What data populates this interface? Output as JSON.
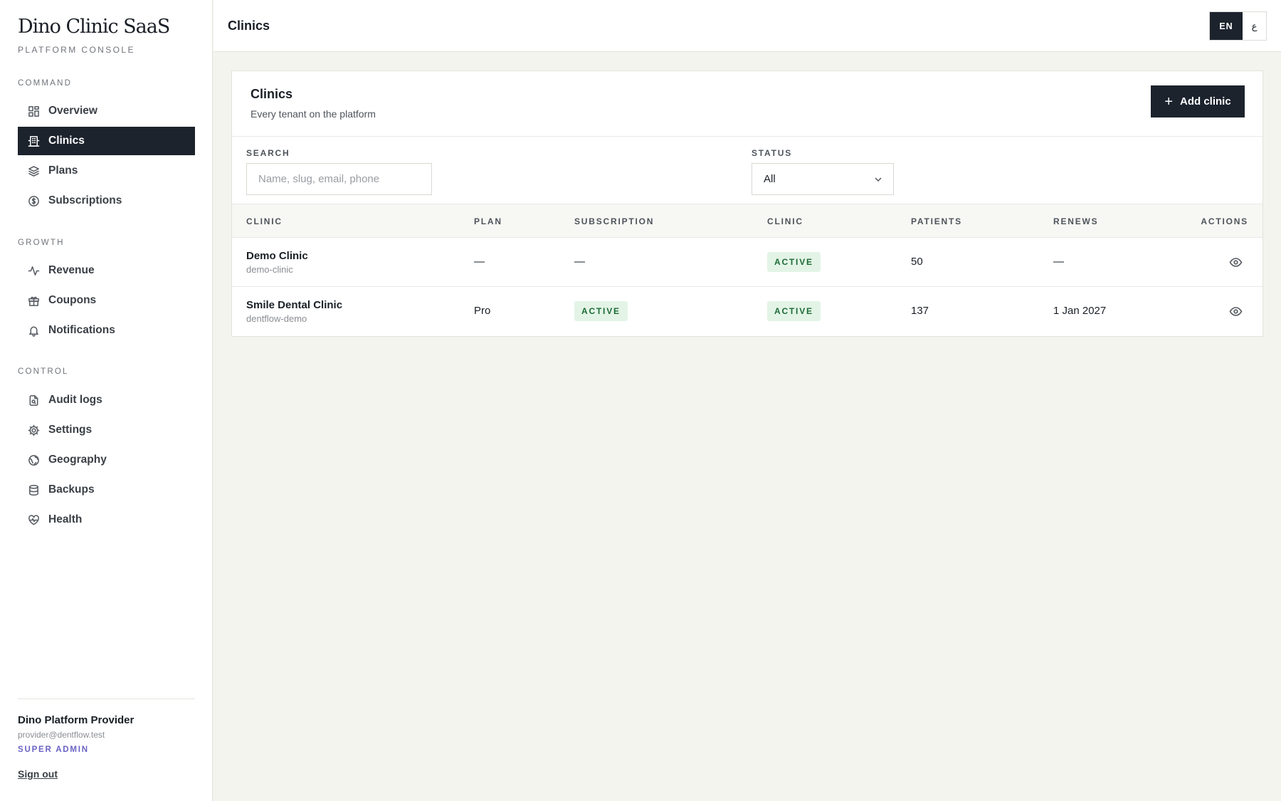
{
  "brand": {
    "title": "Dino Clinic SaaS",
    "subtitle": "PLATFORM CONSOLE"
  },
  "sidebar": {
    "sections": [
      {
        "label": "COMMAND"
      },
      {
        "label": "GROWTH"
      },
      {
        "label": "CONTROL"
      }
    ],
    "items": [
      {
        "label": "Overview",
        "icon": "grid-icon"
      },
      {
        "label": "Clinics",
        "icon": "building-icon",
        "active": true
      },
      {
        "label": "Plans",
        "icon": "layers-icon"
      },
      {
        "label": "Subscriptions",
        "icon": "dollar-circle-icon"
      },
      {
        "label": "Revenue",
        "icon": "activity-icon"
      },
      {
        "label": "Coupons",
        "icon": "gift-icon"
      },
      {
        "label": "Notifications",
        "icon": "bell-icon"
      },
      {
        "label": "Audit logs",
        "icon": "file-search-icon"
      },
      {
        "label": "Settings",
        "icon": "gear-icon"
      },
      {
        "label": "Geography",
        "icon": "globe-icon"
      },
      {
        "label": "Backups",
        "icon": "database-icon"
      },
      {
        "label": "Health",
        "icon": "heart-pulse-icon"
      }
    ],
    "user": {
      "name": "Dino Platform Provider",
      "email": "provider@dentflow.test",
      "role": "SUPER ADMIN",
      "sign_out": "Sign out"
    }
  },
  "topbar": {
    "title": "Clinics",
    "lang_en": "EN",
    "lang_ar": "ع"
  },
  "card": {
    "title": "Clinics",
    "subtitle": "Every tenant on the platform",
    "add_button": "Add clinic",
    "search_label": "SEARCH",
    "search_placeholder": "Name, slug, email, phone",
    "status_label": "STATUS",
    "status_value": "All"
  },
  "table": {
    "columns": [
      "CLINIC",
      "PLAN",
      "SUBSCRIPTION",
      "CLINIC",
      "PATIENTS",
      "RENEWS",
      "ACTIONS"
    ],
    "rows": [
      {
        "name": "Demo Clinic",
        "slug": "demo-clinic",
        "plan": "—",
        "subscription": "—",
        "clinic_status": "ACTIVE",
        "patients": "50",
        "renews": "—"
      },
      {
        "name": "Smile Dental Clinic",
        "slug": "dentflow-demo",
        "plan": "Pro",
        "subscription": "ACTIVE",
        "clinic_status": "ACTIVE",
        "patients": "137",
        "renews": "1 Jan 2027"
      }
    ]
  },
  "colors": {
    "accent_dark": "#1c232d",
    "badge_bg": "#e3f4e6",
    "badge_text": "#1d6a36",
    "role_color": "#6a63c4"
  }
}
